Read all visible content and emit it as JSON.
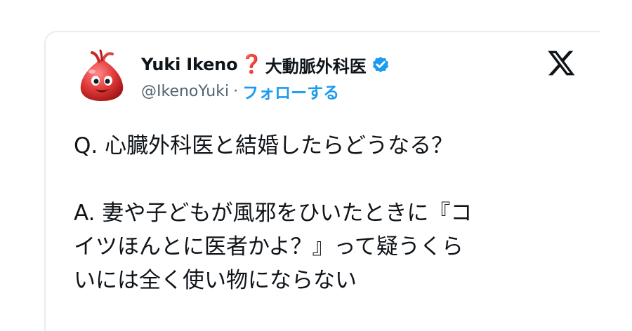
{
  "tweet": {
    "author_name": "Yuki Ikeno",
    "author_name_emoji": "❓",
    "author_name_suffix": "大動脈外科医",
    "verified_icon": "verified-badge-icon",
    "handle": "@IkenoYuki",
    "separator": "·",
    "follow_label": "フォローする",
    "platform_icon": "x-logo-icon",
    "avatar_icon": "red-slime-character-avatar",
    "text_lines": [
      "Q. 心臓外科医と結婚したらどうなる？",
      "A. 妻や子どもが風邪をひいたときに『コ",
      "イツほんとに医者かよ？』って疑うくら",
      "いには全く使い物にならない"
    ]
  },
  "colors": {
    "accent": "#1d9bf0",
    "text": "#0f1419",
    "secondary": "#536471",
    "question_mark": "#e0242e"
  }
}
